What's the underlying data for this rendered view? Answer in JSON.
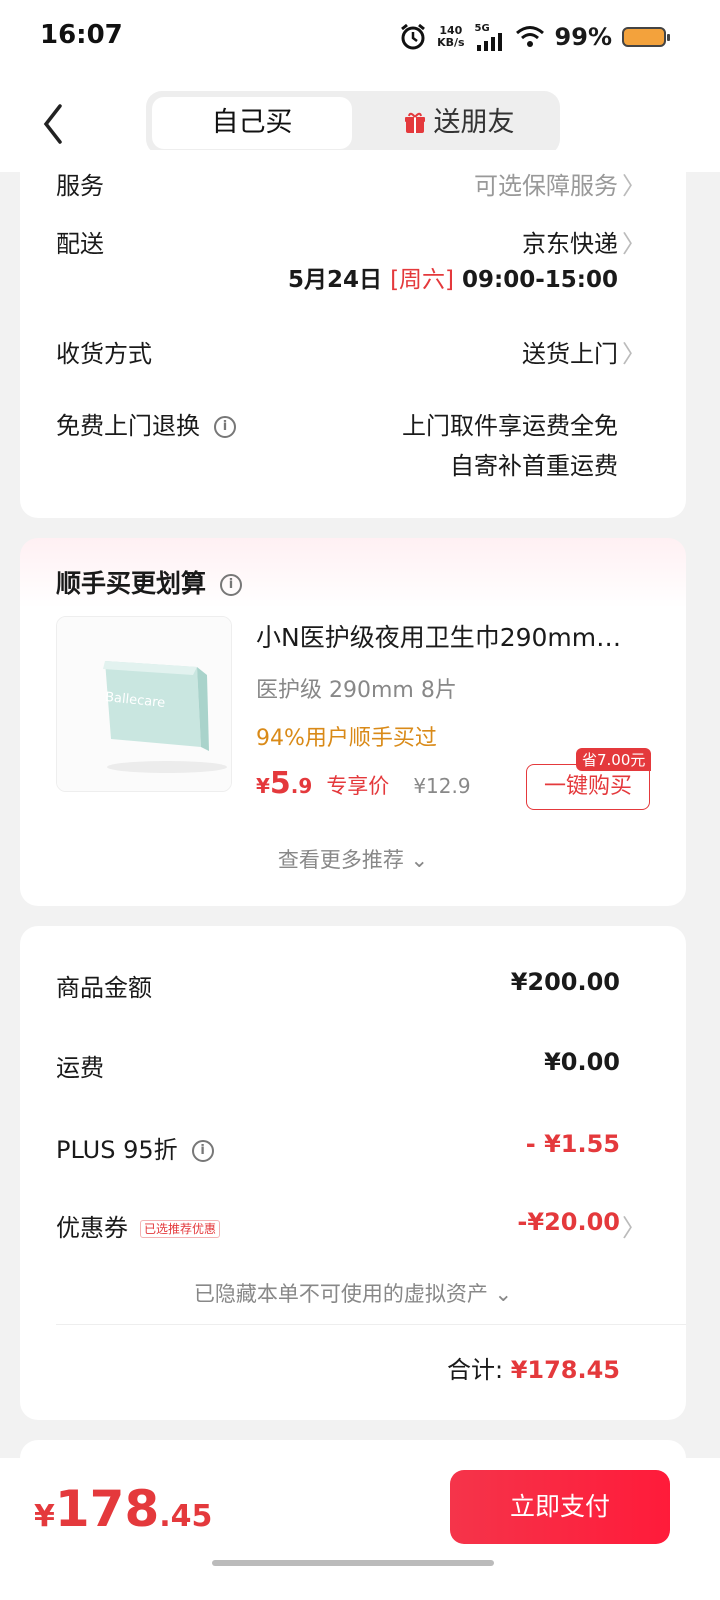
{
  "status_bar": {
    "time": "16:07",
    "speed_value": "140",
    "speed_unit": "KB/s",
    "network": "5G",
    "battery": "99%"
  },
  "header": {
    "tab_self": "自己买",
    "tab_gift": "送朋友"
  },
  "order_info": {
    "service_label": "服务",
    "service_value": "可选保障服务",
    "delivery_label": "配送",
    "delivery_value": "京东快递",
    "delivery_date": "5月24日",
    "delivery_weekday": "[周六]",
    "delivery_time": "09:00-15:00",
    "receive_label": "收货方式",
    "receive_value": "送货上门",
    "return_label": "免费上门退换",
    "return_value_1": "上门取件享运费全免",
    "return_value_2": "自寄补首重运费"
  },
  "recommend": {
    "title": "顺手买更划算",
    "product_name": "小N医护级夜用卫生巾290mm…",
    "product_spec": "医护级 290mm 8片",
    "product_tag": "94%用户顺手买过",
    "price_symbol": "¥",
    "price_int": "5",
    "price_dec": ".9",
    "price_label": "专享价",
    "orig_price": "¥12.9",
    "save_badge": "省7.00元",
    "buy_button": "一键购买",
    "more_text": "查看更多推荐",
    "product_brand_text": "Ballecare"
  },
  "summary": {
    "goods_label": "商品金额",
    "goods_value": "¥200.00",
    "freight_label": "运费",
    "freight_value": "¥0.00",
    "plus_label": "PLUS 95折",
    "plus_value": "- ¥1.55",
    "coupon_label": "优惠券",
    "coupon_tag": "已选推荐优惠",
    "coupon_value": "-¥20.00",
    "hidden_text": "已隐藏本单不可使用的虚拟资产",
    "total_label": "合计:",
    "total_value": "¥178.45"
  },
  "bottom": {
    "sym": "¥",
    "int": "178",
    "dec": ".45",
    "pay_button": "立即支付"
  },
  "colors": {
    "accent_red": "#e4393c",
    "tag_orange": "#d98a18"
  },
  "icons": [
    "back-icon",
    "gift-icon",
    "info-icon",
    "chevron-right-icon",
    "chevron-down-icon",
    "alarm-icon",
    "signal-icon",
    "wifi-icon",
    "battery-icon"
  ]
}
